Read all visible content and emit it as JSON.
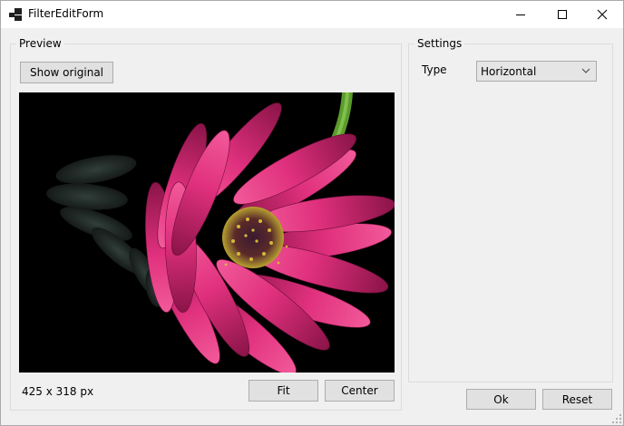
{
  "window": {
    "title": "FilterEditForm"
  },
  "preview": {
    "group_label": "Preview",
    "show_original_label": "Show original",
    "image_alt": "pink daisy flower on black background",
    "image_size": "425 x 318 px",
    "fit_label": "Fit",
    "center_label": "Center"
  },
  "settings": {
    "group_label": "Settings",
    "type_label": "Type",
    "type_value": "Horizontal"
  },
  "footer": {
    "ok_label": "Ok",
    "reset_label": "Reset"
  },
  "colors": {
    "accent": "#0078d7",
    "petal": "#e0307d",
    "stem": "#6aab3a"
  }
}
